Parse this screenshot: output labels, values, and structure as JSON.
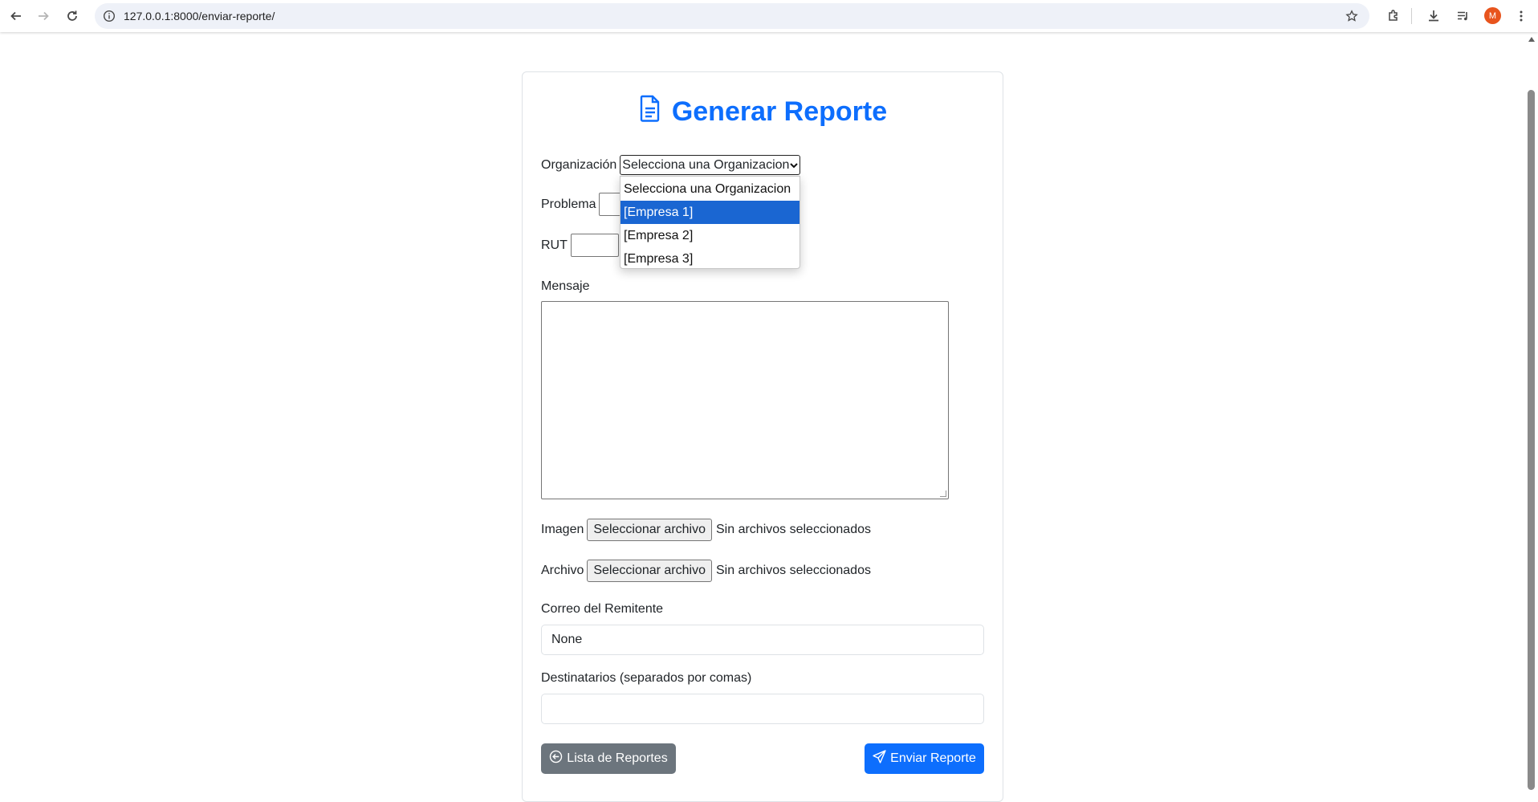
{
  "browser": {
    "url": "127.0.0.1:8000/enviar-reporte/",
    "profile_initial": "M",
    "profile_color": "#e8541d"
  },
  "page": {
    "title": "Generar Reporte",
    "accent": "#0d6efd",
    "organization": {
      "label": "Organización",
      "selected": "Selecciona una Organizacion",
      "options": [
        "Selecciona una Organizacion",
        "[Empresa 1]",
        "[Empresa 2]",
        "[Empresa 3]"
      ],
      "highlighted_option": "[Empresa 1]"
    },
    "problem": {
      "label": "Problema",
      "value": ""
    },
    "rut": {
      "label": "RUT",
      "value": ""
    },
    "message": {
      "label": "Mensaje",
      "value": ""
    },
    "image": {
      "label": "Imagen",
      "button": "Seleccionar archivo",
      "status": "Sin archivos seleccionados"
    },
    "file": {
      "label": "Archivo",
      "button": "Seleccionar archivo",
      "status": "Sin archivos seleccionados"
    },
    "sender_email": {
      "label": "Correo del Remitente",
      "value": "None"
    },
    "recipients": {
      "label": "Destinatarios (separados por comas)",
      "value": ""
    },
    "buttons": {
      "list": "Lista de Reportes",
      "list_color": "#6c757d",
      "send": "Enviar Reporte",
      "send_color": "#0d6efd"
    }
  }
}
